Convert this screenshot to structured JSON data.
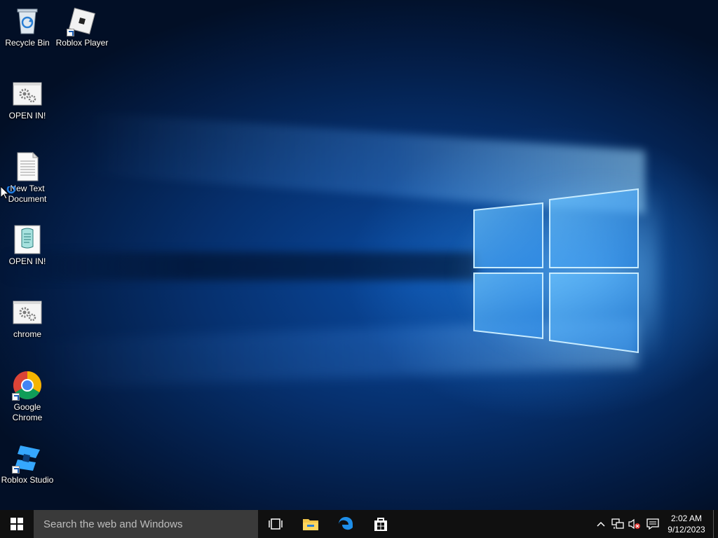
{
  "desktop": {
    "icons": [
      {
        "label": "Recycle Bin",
        "icon": "recycle-bin-icon",
        "shortcut": false
      },
      {
        "label": "Roblox Player",
        "icon": "roblox-player-icon",
        "shortcut": true
      },
      {
        "label": "OPEN IN!",
        "icon": "settings-file-icon",
        "shortcut": false
      },
      {
        "label": "New Text Document",
        "icon": "text-document-icon",
        "shortcut": false
      },
      {
        "label": "OPEN IN!",
        "icon": "script-file-icon",
        "shortcut": false
      },
      {
        "label": "chrome",
        "icon": "settings-file-icon",
        "shortcut": false
      },
      {
        "label": "Google Chrome",
        "icon": "chrome-icon",
        "shortcut": true
      },
      {
        "label": "Roblox Studio",
        "icon": "roblox-studio-icon",
        "shortcut": true
      }
    ]
  },
  "taskbar": {
    "search_placeholder": "Search the web and Windows",
    "pinned": [
      "task-view-icon",
      "file-explorer-icon",
      "edge-icon",
      "store-icon"
    ],
    "tray_icons": [
      "chevron-up-icon",
      "network-icon",
      "volume-muted-icon",
      "action-center-icon"
    ],
    "clock": {
      "time": "2:02 AM",
      "date": "9/12/2023"
    }
  },
  "colors": {
    "taskbar_bg": "#101010",
    "search_bg": "#3a3a3a",
    "desktop_blue": "#0a4aa0",
    "accent_light": "#9fd6ff"
  }
}
